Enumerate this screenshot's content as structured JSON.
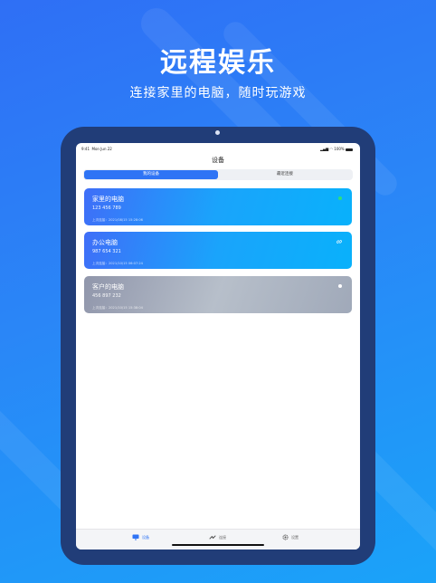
{
  "hero": {
    "title": "远程娱乐",
    "subtitle": "连接家里的电脑，随时玩游戏"
  },
  "status_bar": {
    "time": "9:41",
    "date": "Mon Jun 22",
    "battery": "100%"
  },
  "nav": {
    "title": "设备"
  },
  "segment": {
    "tabs": [
      {
        "label": "我的设备",
        "active": true
      },
      {
        "label": "最近连接",
        "active": false
      }
    ]
  },
  "devices": [
    {
      "name": "家里的电脑",
      "id": "123 456 789",
      "last_connected": "上次连接：2021/08/15 15:28:06",
      "status": "online-dot",
      "color": "#2ee07a"
    },
    {
      "name": "办公电脑",
      "id": "987 654 321",
      "last_connected": "上次连接：2021/10/15 06:07:24",
      "status": "link-icon"
    },
    {
      "name": "客户的电脑",
      "id": "456 897 232",
      "last_connected": "上次连接：2021/10/15 15:38:04",
      "status": "offline-dot",
      "color": "#ffffff"
    }
  ],
  "tabbar": {
    "items": [
      {
        "label": "设备",
        "icon": "monitor-icon",
        "active": true
      },
      {
        "label": "连接",
        "icon": "connect-icon",
        "active": false
      },
      {
        "label": "设置",
        "icon": "gear-icon",
        "active": false
      }
    ]
  },
  "colors": {
    "accent": "#2f74f5",
    "tablet_frame": "#213d78"
  }
}
